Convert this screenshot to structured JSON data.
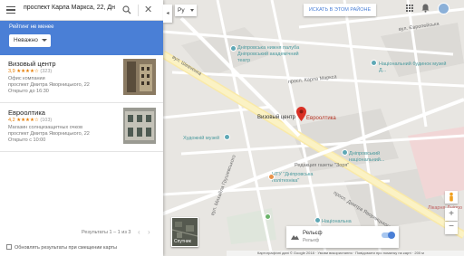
{
  "search": {
    "query": "проспект Карла Маркса, 22, Дн"
  },
  "filter": {
    "label": "Рейтинг не менее",
    "selected": "Неважно"
  },
  "results": [
    {
      "name": "Визовый центр",
      "rating": "3,9",
      "stars": "★★★★☆",
      "count": "(323)",
      "category": "Офис компании",
      "address": "проспект Дмитра Яворницького, 22",
      "hours": "Открыто до 16:30"
    },
    {
      "name": "Евроолтика",
      "rating": "4,2",
      "stars": "★★★★☆",
      "count": "(103)",
      "category": "Магазин солнцезащитных очков",
      "address": "проспект Дмитра Яворницького, 22",
      "hours": "Открыто с 10:00"
    }
  ],
  "pagination": {
    "text": "Результаты 1 – 1 из 3",
    "prev": "‹",
    "next": "›"
  },
  "update_checkbox": {
    "label": "Обновлять результаты при смещении карты"
  },
  "collapse_tab": "◂",
  "language": {
    "selected": "Ру"
  },
  "search_area_button": "ИСКАТЬ В ЭТОМ РАЙОНЕ",
  "map": {
    "labels": {
      "embankment_nab": "Дніпровська нижня палуба",
      "theatre": "Дніпровський академічний театр",
      "museum": "Національний будинок музей Д...",
      "karla_marks": "просп. Карла Маркса",
      "visa_center": "Визовый центр",
      "evrooptika": "Евроолтика",
      "art_museum": "Художній музей",
      "dnipro_museum": "Дніпровський національний...",
      "newspaper": "Редакция газеты \"Зоря\"",
      "ntu": "НТУ \"Дніпровська політехніка\"",
      "natsionalna": "Національна",
      "hospital": "Лікарня Дніпро",
      "yavornytskoho": "просп. Дмитра Яворницького",
      "street_a": "вул. Шевченка",
      "street_b": "вул. Михайла Грушевського",
      "street_c": "вул. Європейська"
    },
    "accent": "#4a7fd6",
    "pin_color": "#d93025"
  },
  "controls": {
    "satellite_label": "Спутник",
    "relief_label": "Рельєф",
    "relief_sub": "Рельеф",
    "zoom_in": "+",
    "zoom_out": "−"
  },
  "footer": "Картографічні дані © Google 2018 · Умови використання · Повідомити про помилку на карті · 200 м"
}
